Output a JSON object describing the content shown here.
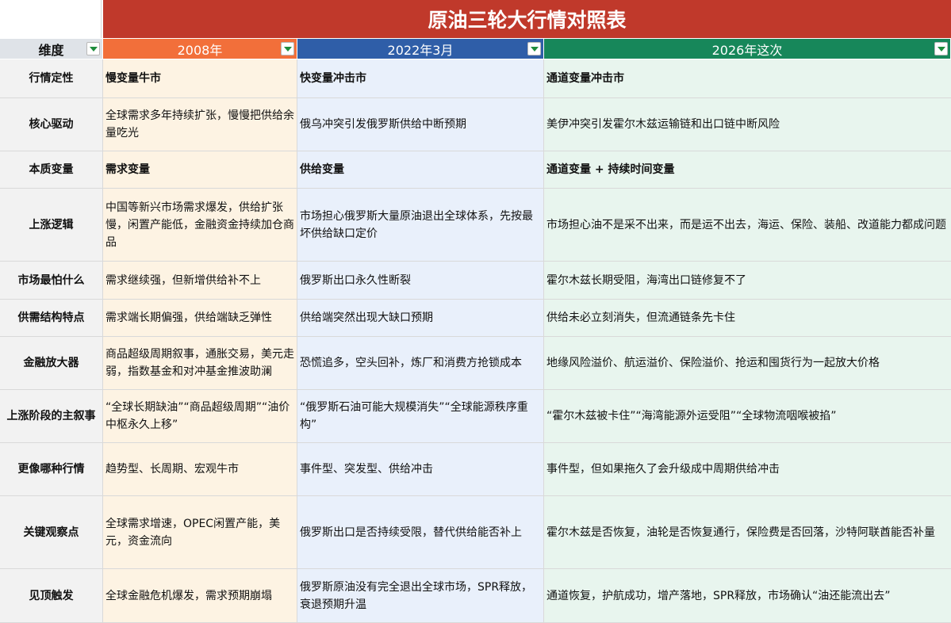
{
  "title": "原油三轮大行情对照表",
  "colors": {
    "title_bg": "#c0392b",
    "col_2008": "#f26f3a",
    "col_2022": "#2f5ea8",
    "col_2026": "#17875a",
    "dimension_header": "#dfe3e8",
    "dropdown_arrow": "#1e8c3c"
  },
  "columns": [
    {
      "label": "维度",
      "filter_icon": "dropdown-arrow-icon"
    },
    {
      "label": "2008年",
      "filter_icon": "dropdown-arrow-icon"
    },
    {
      "label": "2022年3月",
      "filter_icon": "dropdown-arrow-icon"
    },
    {
      "label": "2026年这次",
      "filter_icon": "dropdown-arrow-icon"
    }
  ],
  "rows": [
    {
      "dim": "行情定性",
      "c2008": "慢变量牛市",
      "c2022": "快变量冲击市",
      "c2026": "通道变量冲击市",
      "bold": true
    },
    {
      "dim": "核心驱动",
      "c2008": "全球需求多年持续扩张，慢慢把供给余量吃光",
      "c2022": "俄乌冲突引发俄罗斯供给中断预期",
      "c2026": "美伊冲突引发霍尔木兹运输链和出口链中断风险",
      "bold": false
    },
    {
      "dim": "本质变量",
      "c2008": "需求变量",
      "c2022": "供给变量",
      "c2026": "通道变量 + 持续时间变量",
      "bold": true
    },
    {
      "dim": "上涨逻辑",
      "c2008": "中国等新兴市场需求爆发，供给扩张慢，闲置产能低，金融资金持续加仓商品",
      "c2022": "市场担心俄罗斯大量原油退出全球体系，先按最坏供给缺口定价",
      "c2026": "市场担心油不是采不出来，而是运不出去，海运、保险、装船、改道能力都成问题",
      "bold": false
    },
    {
      "dim": "市场最怕什么",
      "c2008": "需求继续强，但新增供给补不上",
      "c2022": "俄罗斯出口永久性断裂",
      "c2026": "霍尔木兹长期受阻，海湾出口链修复不了",
      "bold": false
    },
    {
      "dim": "供需结构特点",
      "c2008": "需求端长期偏强，供给端缺乏弹性",
      "c2022": "供给端突然出现大缺口预期",
      "c2026": "供给未必立刻消失，但流通链条先卡住",
      "bold": false
    },
    {
      "dim": "金融放大器",
      "c2008": "商品超级周期叙事，通胀交易，美元走弱，指数基金和对冲基金推波助澜",
      "c2022": "恐慌追多，空头回补，炼厂和消费方抢锁成本",
      "c2026": "地缘风险溢价、航运溢价、保险溢价、抢运和囤货行为一起放大价格",
      "bold": false
    },
    {
      "dim": "上涨阶段的主叙事",
      "c2008": "“全球长期缺油”“商品超级周期”“油价中枢永久上移”",
      "c2022": "“俄罗斯石油可能大规模消失”“全球能源秩序重构”",
      "c2026": "“霍尔木兹被卡住”“海湾能源外运受阻”“全球物流咽喉被掐”",
      "bold": false
    },
    {
      "dim": "更像哪种行情",
      "c2008": "趋势型、长周期、宏观牛市",
      "c2022": "事件型、突发型、供给冲击",
      "c2026": "事件型，但如果拖久了会升级成中周期供给冲击",
      "bold": false
    },
    {
      "dim": "关键观察点",
      "c2008": "全球需求增速，OPEC闲置产能，美元，资金流向",
      "c2022": "俄罗斯出口是否持续受限，替代供给能否补上",
      "c2026": "霍尔木兹是否恢复，油轮是否恢复通行，保险费是否回落，沙特阿联酋能否补量",
      "bold": false
    },
    {
      "dim": "见顶触发",
      "c2008": "全球金融危机爆发，需求预期崩塌",
      "c2022": "俄罗斯原油没有完全退出全球市场，SPR释放，衰退预期升温",
      "c2026": "通道恢复，护航成功，增产落地，SPR释放，市场确认“油还能流出去”",
      "bold": false
    }
  ]
}
